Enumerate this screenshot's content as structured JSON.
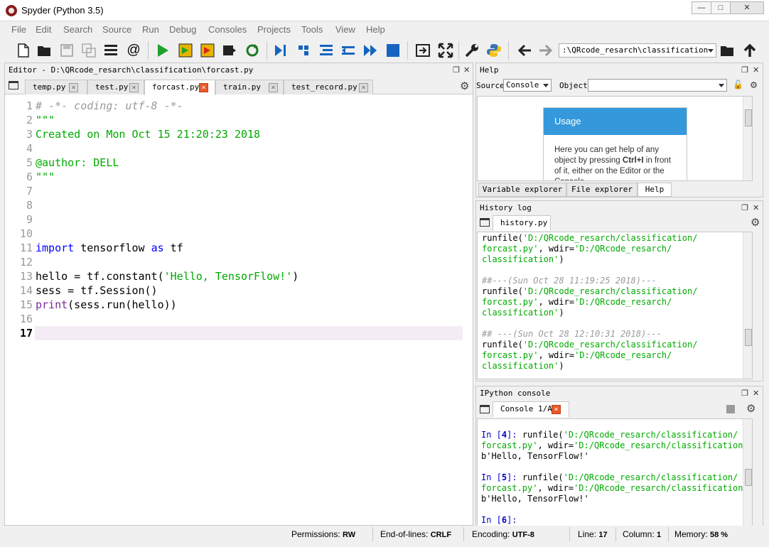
{
  "window": {
    "title": "Spyder (Python 3.5)"
  },
  "menu": [
    "File",
    "Edit",
    "Search",
    "Source",
    "Run",
    "Debug",
    "Consoles",
    "Projects",
    "Tools",
    "View",
    "Help"
  ],
  "toolbar": {
    "path": ":\\QRcode_resarch\\classification"
  },
  "editor": {
    "title": "Editor - D:\\QRcode_resarch\\classification\\forcast.py",
    "tabs": [
      "temp.py",
      "test.py",
      "forcast.py",
      "train.py",
      "test_record.py"
    ],
    "active_tab": "forcast.py",
    "line_numbers": [
      "1",
      "2",
      "3",
      "4",
      "5",
      "6",
      "7",
      "8",
      "9",
      "10",
      "11",
      "12",
      "13",
      "14",
      "15",
      "16",
      "17"
    ],
    "current_line": "17",
    "lines": {
      "l1": "# -*- coding: utf-8 -*-",
      "l2": "\"\"\"",
      "l3": "Created on Mon Oct 15 21:20:23 2018",
      "l5": "@author: DELL",
      "l6": "\"\"\"",
      "l11_kw1": "import",
      "l11_mid": " tensorflow ",
      "l11_kw2": "as",
      "l11_end": " tf",
      "l13_a": "hello = tf.constant(",
      "l13_str": "'Hello, TensorFlow!'",
      "l13_b": ")",
      "l14": "sess = tf.Session()",
      "l15_fn": "print",
      "l15_rest": "(sess.run(hello))"
    }
  },
  "help": {
    "title": "Help",
    "source_label": "Source",
    "source_value": "Console",
    "object_label": "Object",
    "usage_title": "Usage",
    "usage_text_a": "Here you can get help of any object by pressing ",
    "usage_shortcut": "Ctrl+I",
    "usage_text_b": " in front of it, either on the Editor or the Console.",
    "tabs": [
      "Variable explorer",
      "File explorer",
      "Help"
    ]
  },
  "history": {
    "title": "History log",
    "tab": "history.py",
    "entries": {
      "e1a": "runfile(",
      "e1s1": "'D:/QRcode_resarch/classification/",
      "e1s2": "forcast.py'",
      "e1b": ", wdir=",
      "e1s3": "'D:/QRcode_resarch/",
      "e1s4": "classification'",
      "e1c": ")",
      "c2": "##---(Sun Oct 28 11:19:25 2018)---",
      "c3": "## ---(Sun Oct 28 12:10:31 2018)---"
    }
  },
  "ipython": {
    "title": "IPython console",
    "tab": "Console 1/A",
    "prompt_in": "In [",
    "prompt_close": "]: ",
    "n4": "4",
    "n5": "5",
    "n6": "6",
    "runfile": "runfile(",
    "path_a": "'D:/QRcode_resarch/classification/",
    "path_b": "forcast.py'",
    "wdir": ", wdir=",
    "path_c": "'D:/QRcode_resarch/classification'",
    "close": ")",
    "output": "b'Hello, TensorFlow!'",
    "last_prompt_close": "]:"
  },
  "status": {
    "permissions_label": "Permissions:",
    "permissions": "RW",
    "eol_label": "End-of-lines:",
    "eol": "CRLF",
    "encoding_label": "Encoding:",
    "encoding": "UTF-8",
    "line_label": "Line:",
    "line": "17",
    "column_label": "Column:",
    "column": "1",
    "memory_label": "Memory:",
    "memory": "58 %"
  }
}
